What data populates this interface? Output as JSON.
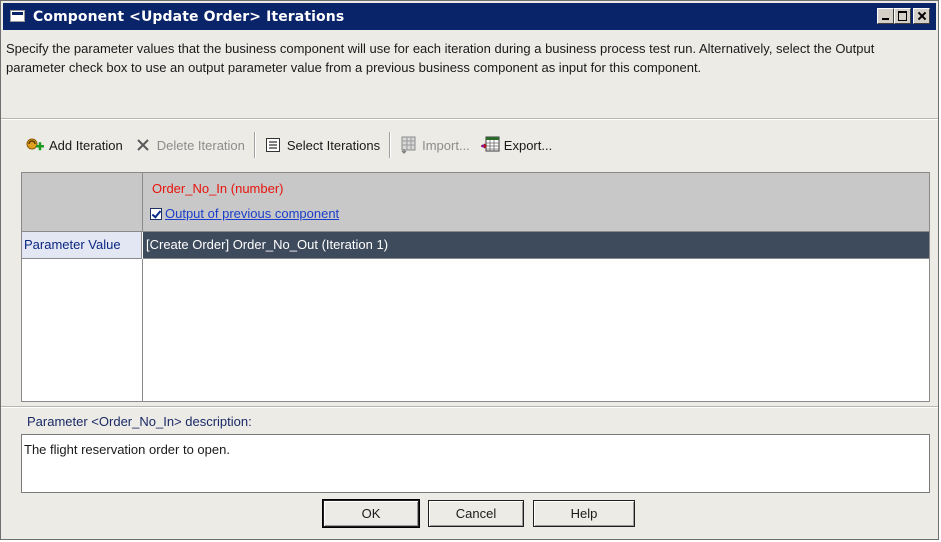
{
  "window": {
    "title": "Component <Update Order> Iterations"
  },
  "description": "Specify the parameter values that the business component will use for each iteration during a business process test run. Alternatively, select the Output parameter check box to use an output parameter value from a previous business component as input for this component.",
  "toolbar": {
    "add_iteration": "Add Iteration",
    "delete_iteration": "Delete Iteration",
    "select_iterations": "Select Iterations",
    "import": "Import...",
    "export": "Export..."
  },
  "grid": {
    "column_header": "Order_No_In (number)",
    "output_checkbox_label": "Output of previous component",
    "output_checked": true,
    "row_header": "Parameter Value",
    "row_value": "[Create Order] Order_No_Out (Iteration 1)"
  },
  "param_description": {
    "label": "Parameter <Order_No_In> description:",
    "text": "The flight reservation order to open."
  },
  "buttons": {
    "ok": "OK",
    "cancel": "Cancel",
    "help": "Help"
  },
  "colors": {
    "title_bar": "#0a246a",
    "param_name": "#e8140c",
    "selected_row": "#3e4b5c",
    "link": "#1a3ec9"
  }
}
